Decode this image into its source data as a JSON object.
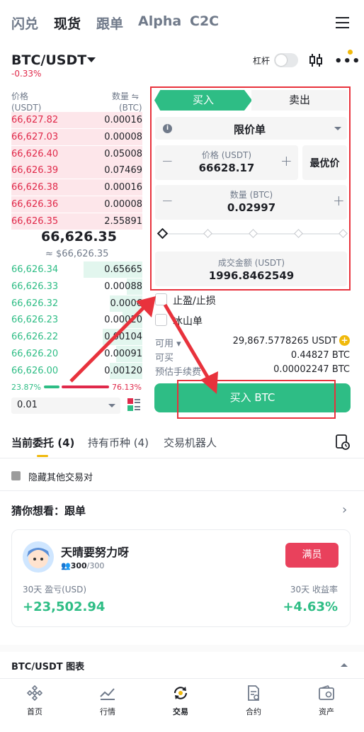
{
  "top_nav": {
    "items": [
      "闪兑",
      "现货",
      "跟单",
      "Alpha",
      "C2C"
    ],
    "active": "现货"
  },
  "header": {
    "pair": "BTC/USDT",
    "change": "-0.33%",
    "leverage_label": "杠杆"
  },
  "orderbook": {
    "price_header": "价格",
    "price_unit": "(USDT)",
    "qty_header": "数量 ⇋",
    "qty_unit": "(BTC)",
    "asks": [
      {
        "price": "66,627.82",
        "qty": "0.00016"
      },
      {
        "price": "66,627.03",
        "qty": "0.00008"
      },
      {
        "price": "66,626.40",
        "qty": "0.05008"
      },
      {
        "price": "66,626.39",
        "qty": "0.07469"
      },
      {
        "price": "66,626.38",
        "qty": "0.00016"
      },
      {
        "price": "66,626.36",
        "qty": "0.00008"
      },
      {
        "price": "66,626.35",
        "qty": "2.55891"
      }
    ],
    "last_price": "66,626.35",
    "last_price_usd": "≈ $66,626.35",
    "bids": [
      {
        "price": "66,626.34",
        "qty": "0.65665",
        "depth": 0.45
      },
      {
        "price": "66,626.33",
        "qty": "0.00088",
        "depth": 0.12
      },
      {
        "price": "66,626.32",
        "qty": "0.0006",
        "depth": 0.25
      },
      {
        "price": "66,626.23",
        "qty": "0.00020",
        "depth": 0.15
      },
      {
        "price": "66,626.22",
        "qty": "0.00104",
        "depth": 0.3
      },
      {
        "price": "66,626.20",
        "qty": "0.00091",
        "depth": 0.2
      },
      {
        "price": "66,626.00",
        "qty": "0.00120",
        "depth": 0.25
      }
    ],
    "buy_ratio": "23.87%",
    "sell_ratio": "76.13%",
    "buy_ratio_value": 0.2387,
    "depth_step": "0.01"
  },
  "order_form": {
    "buy_tab": "买入",
    "sell_tab": "卖出",
    "order_type": "限价单",
    "price_label": "价格 (USDT)",
    "price_value": "66628.17",
    "best_price": "最优价",
    "qty_label": "数量 (BTC)",
    "qty_value": "0.02997",
    "total_label": "成交金额 (USDT)",
    "total_value": "1996.8462549",
    "tpsl_label": "止盈/止损",
    "iceberg_label": "冰山单",
    "available_label": "可用",
    "available_value": "29,867.5778265 USDT",
    "can_buy_label": "可买",
    "can_buy_value": "0.44827 BTC",
    "fee_label": "预估手续费",
    "fee_value": "0.00002247 BTC",
    "submit": "买入 BTC"
  },
  "orders_tabs": {
    "open_orders": "当前委托 (4)",
    "holdings": "持有币种 (4)",
    "bots": "交易机器人"
  },
  "hide_pairs": "隐藏其他交易对",
  "suggest": {
    "title": "猜你想看：跟单"
  },
  "copy_card": {
    "name": "天晴要努力呀",
    "followers": "300",
    "followers_max": "/300",
    "full_button": "满员",
    "pnl_label": "30天 盈亏(USD)",
    "pnl_value": "+23,502.94",
    "roi_label": "30天 收益率",
    "roi_value": "+4.63%"
  },
  "chart_section": {
    "title": "BTC/USDT 图表"
  },
  "bottom_nav": {
    "items": [
      "首页",
      "行情",
      "交易",
      "合约",
      "资产"
    ],
    "active": "交易"
  },
  "colors": {
    "green": "#2ebd85",
    "red": "#e0294a",
    "annotation": "#e8323c",
    "brand": "#f0b90b"
  }
}
